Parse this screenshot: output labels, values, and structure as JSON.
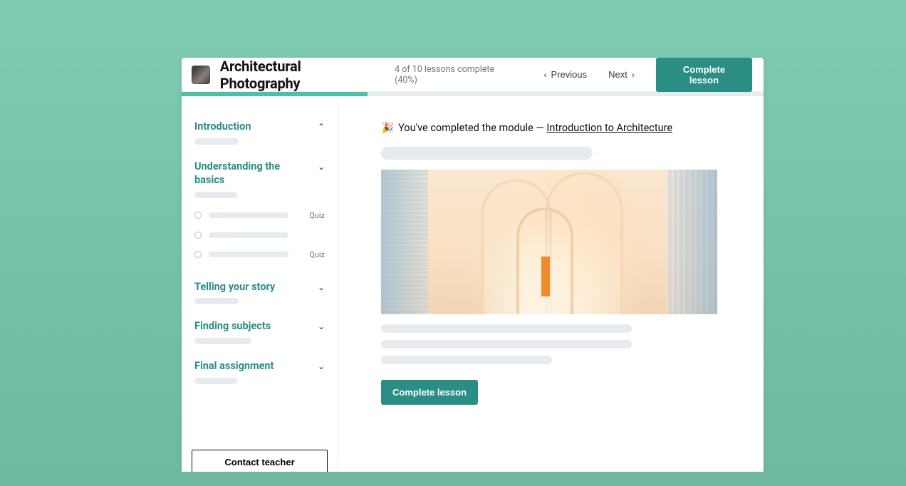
{
  "header": {
    "course_title": "Architectural Photography",
    "progress_text": "4 of 10 lessons complete (40%)",
    "prev_label": "Previous",
    "next_label": "Next",
    "complete_label": "Complete lesson"
  },
  "sidebar": {
    "modules": [
      {
        "title": "Introduction",
        "expanded": true
      },
      {
        "title": "Understanding the basics",
        "expanded": true,
        "lessons": [
          {
            "tag": "Quiz"
          },
          {
            "tag": ""
          },
          {
            "tag": "Quiz"
          }
        ]
      },
      {
        "title": "Telling your story",
        "expanded": false
      },
      {
        "title": "Finding subjects",
        "expanded": false
      },
      {
        "title": "Final assignment",
        "expanded": false
      }
    ],
    "contact_label": "Contact teacher"
  },
  "main": {
    "completion_prefix": "You've completed the module — ",
    "completion_link": "Introduction to Architecture",
    "emoji": "🎉",
    "complete_label": "Complete lesson"
  }
}
